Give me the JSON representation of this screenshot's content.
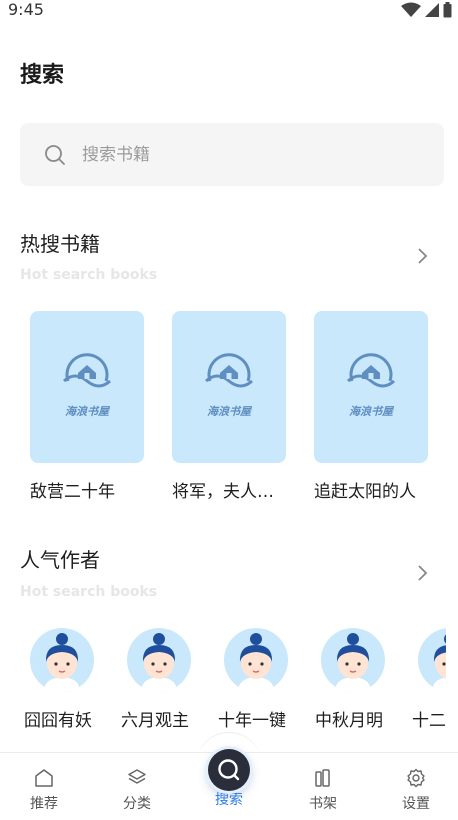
{
  "status": {
    "time": "9:45"
  },
  "page": {
    "title": "搜索"
  },
  "search": {
    "placeholder": "搜索书籍"
  },
  "hot_books": {
    "title": "热搜书籍",
    "subtitle": "Hot search books",
    "cover_logo_text": "海浪书屋",
    "items": [
      {
        "name": "敌营二十年"
      },
      {
        "name": "将军，夫人…"
      },
      {
        "name": "追赶太阳的人"
      }
    ]
  },
  "popular_authors": {
    "title": "人气作者",
    "subtitle": "Hot search books",
    "items": [
      {
        "name": "囧囧有妖"
      },
      {
        "name": "六月观主"
      },
      {
        "name": "十年一键"
      },
      {
        "name": "中秋月明"
      },
      {
        "name": "十二"
      }
    ]
  },
  "tabbar": {
    "items": [
      {
        "label": "推荐",
        "icon": "home-icon"
      },
      {
        "label": "分类",
        "icon": "layers-icon"
      },
      {
        "label": "搜索",
        "icon": "search-icon",
        "active": true
      },
      {
        "label": "书架",
        "icon": "bookshelf-icon"
      },
      {
        "label": "设置",
        "icon": "gear-icon"
      }
    ]
  },
  "colors": {
    "accent": "#2f80ed",
    "cover_bg": "#c9e8fb",
    "logo": "#5f8ec1"
  }
}
